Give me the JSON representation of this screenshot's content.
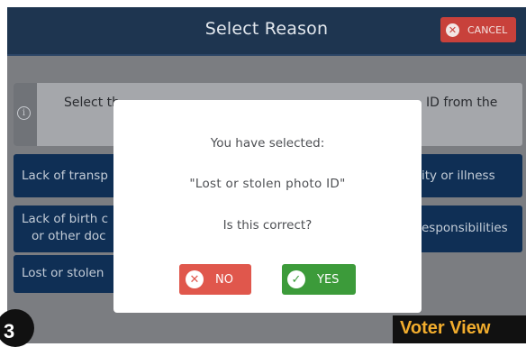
{
  "header": {
    "title": "Select Reason",
    "cancel_label": "CANCEL"
  },
  "instruction": {
    "text_left_visible": "Select th",
    "text_right_visible": "ID from the"
  },
  "reasons": {
    "left": [
      {
        "lines": [
          "Lack of transp"
        ]
      },
      {
        "lines": [
          "Lack of birth c",
          "or other doc"
        ]
      },
      {
        "lines": [
          "Lost or stolen"
        ]
      }
    ],
    "right": [
      {
        "lines": [
          "ity or illness"
        ]
      },
      {
        "lines": [
          "esponsibilities"
        ]
      }
    ]
  },
  "modal": {
    "line1": "You have selected:",
    "selection": "\"Lost or stolen photo ID\"",
    "question": "Is this correct?",
    "no_label": "NO",
    "yes_label": "YES"
  },
  "overlay": {
    "step_number": "3",
    "view_label": "Voter View"
  },
  "colors": {
    "header_bg": "#1e3550",
    "cancel_bg": "#c8413b",
    "reason_bg": "#0f2f55",
    "no_bg": "#e0574c",
    "yes_bg": "#3c9b3a",
    "view_label_color": "#f2ad2d"
  },
  "icons": {
    "cancel": "close-circle-icon",
    "info": "info-icon",
    "no": "close-circle-icon",
    "yes": "check-circle-icon"
  }
}
